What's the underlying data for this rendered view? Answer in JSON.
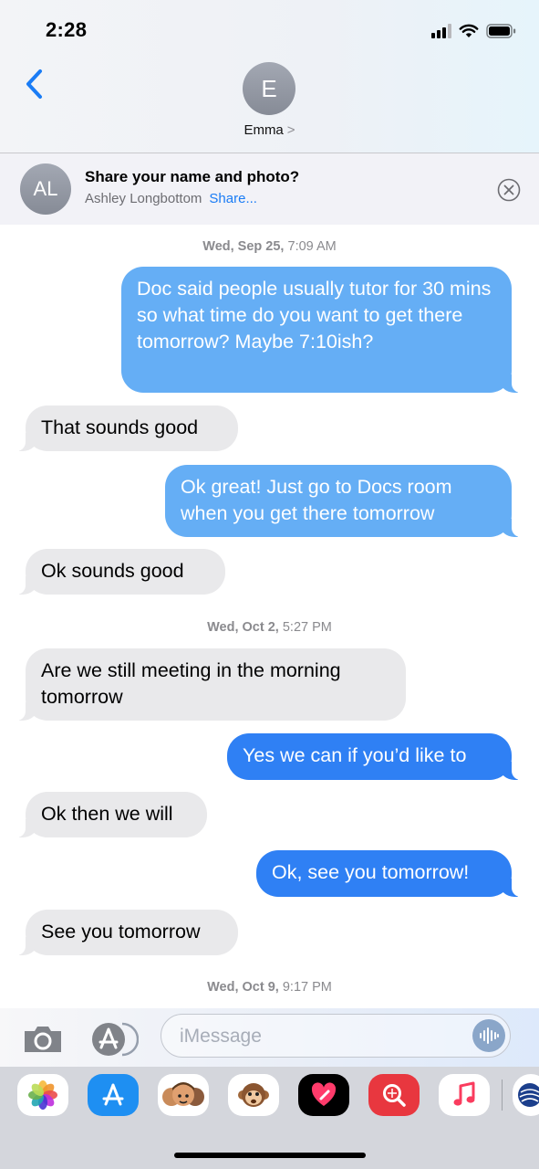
{
  "status_bar": {
    "time": "2:28"
  },
  "header": {
    "contact_initial": "E",
    "contact_name": "Emma",
    "name_chevron": ">"
  },
  "share_banner": {
    "avatar_initials": "AL",
    "title": "Share your name and photo?",
    "name": "Ashley Longbottom",
    "share_link": "Share..."
  },
  "conversation": {
    "timestamps": [
      {
        "day": "Wed, Sep 25,",
        "time": "7:09 AM"
      },
      {
        "day": "Wed, Oct 2,",
        "time": "5:27 PM"
      },
      {
        "day": "Wed, Oct 9,",
        "time": "9:17 PM"
      }
    ],
    "messages": [
      {
        "from": "me",
        "text": "Doc said people usually tutor for 30 mins so what time do you want to get there tomorrow? Maybe 7:10ish?"
      },
      {
        "from": "them",
        "text": "That sounds good"
      },
      {
        "from": "me",
        "text": "Ok great! Just go to Docs room when you get there tomorrow"
      },
      {
        "from": "them",
        "text": "Ok sounds good"
      },
      {
        "from": "them",
        "text": "Are we still meeting in the morning tomorrow"
      },
      {
        "from": "me",
        "text": "Yes we can if you’d like to"
      },
      {
        "from": "them",
        "text": "Ok then we will"
      },
      {
        "from": "me",
        "text": "Ok, see you tomorrow!"
      },
      {
        "from": "them",
        "text": "See you tomorrow"
      }
    ]
  },
  "composer": {
    "placeholder": "iMessage",
    "value": ""
  },
  "app_drawer": {
    "apps": [
      "photos-app",
      "app-store-app",
      "memoji-app",
      "animoji-app",
      "digital-touch-app",
      "search-images-app",
      "music-app",
      "airline-app"
    ]
  },
  "colors": {
    "outgoing": "#2f80f4",
    "outgoing_light": "#65aef5",
    "incoming": "#e9e9eb",
    "accent": "#1a7cf5"
  }
}
